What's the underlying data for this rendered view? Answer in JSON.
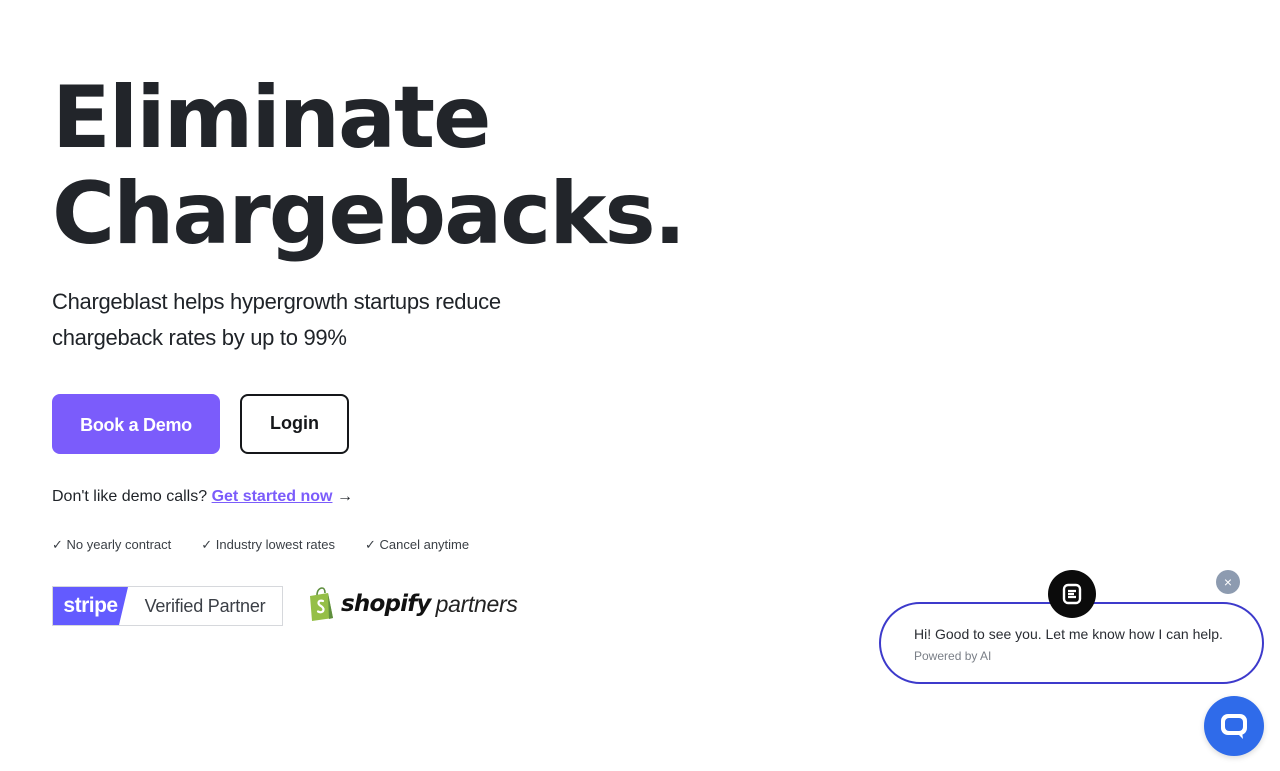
{
  "hero": {
    "title_line1": "Eliminate",
    "title_line2": "Chargebacks.",
    "subtitle": "Chargeblast helps hypergrowth startups reduce chargeback rates by up to 99%"
  },
  "buttons": {
    "demo_label": "Book a Demo",
    "login_label": "Login"
  },
  "cta": {
    "prefix": "Don't like demo calls?",
    "link": "Get started now",
    "arrow": "→"
  },
  "features": [
    "✓ No yearly contract",
    "✓ Industry lowest rates",
    "✓ Cancel anytime"
  ],
  "badges": {
    "stripe_word": "stripe",
    "stripe_verified": "Verified Partner",
    "shopify_word": "shopify",
    "shopify_partners": "partners"
  },
  "chat": {
    "message": "Hi! Good to see you. Let me know how I can help.",
    "powered": "Powered by AI",
    "close_symbol": "×"
  },
  "colors": {
    "accent": "#7b5cfb",
    "stripe": "#635bff",
    "chat_border": "#3d3acb",
    "chat_launcher": "#2f6bea",
    "shopify_green": "#95bf47"
  }
}
